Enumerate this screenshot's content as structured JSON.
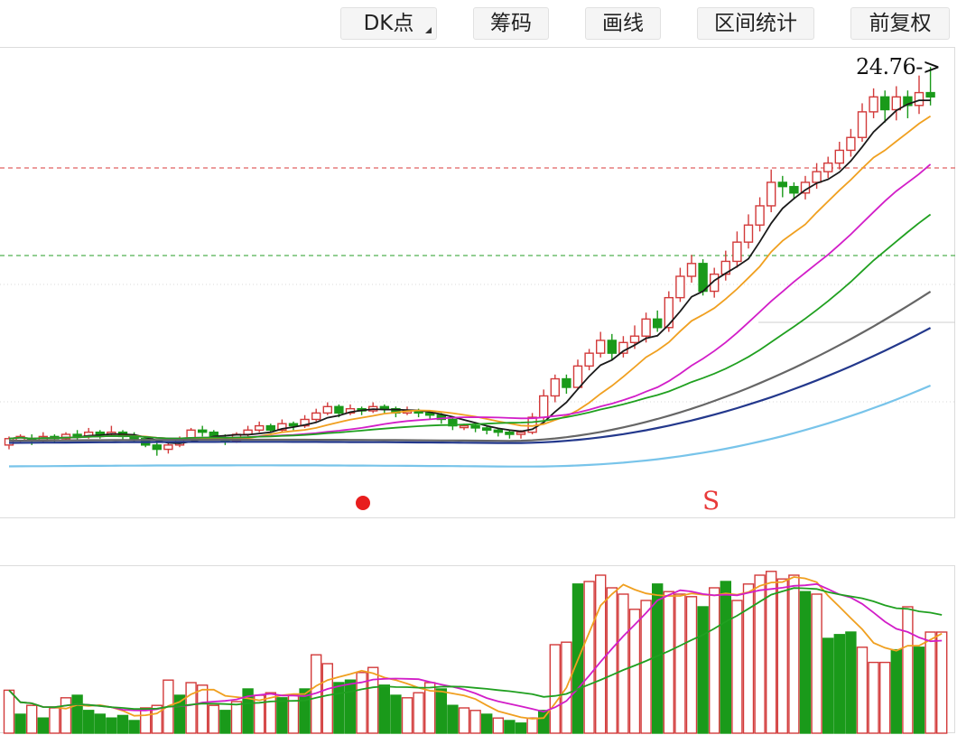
{
  "toolbar": {
    "dk_label": "DK点",
    "chips_label": "筹码",
    "draw_label": "画线",
    "interval_label": "区间统计",
    "adjust_label": "前复权"
  },
  "main_chart": {
    "price_label": "24.76->",
    "sell_marker": "S"
  },
  "colors": {
    "up": "#d23a3a",
    "down": "#1a9a1a",
    "ma5": "#1a1a1a",
    "ma10": "#f0a020",
    "ma20": "#d21ec8",
    "ma30": "#20a020",
    "ma60": "#666666",
    "ma120": "#23388c",
    "ma250": "#78c4ea"
  },
  "chart_data": {
    "type": "candlestick",
    "title": "",
    "reference_lines": [
      {
        "color": "#e06060",
        "style": "dashed"
      },
      {
        "color": "#50b050",
        "style": "dashed"
      }
    ],
    "candles": [
      [
        10.3,
        10.6,
        10.1,
        10.7
      ],
      [
        10.5,
        10.7,
        10.4,
        10.8
      ],
      [
        10.6,
        10.5,
        10.3,
        10.8
      ],
      [
        10.5,
        10.7,
        10.4,
        10.9
      ],
      [
        10.7,
        10.6,
        10.4,
        10.8
      ],
      [
        10.6,
        10.8,
        10.5,
        10.9
      ],
      [
        10.8,
        10.7,
        10.5,
        11.0
      ],
      [
        10.7,
        10.9,
        10.6,
        11.1
      ],
      [
        10.9,
        10.8,
        10.6,
        11.0
      ],
      [
        10.8,
        10.9,
        10.7,
        11.2
      ],
      [
        10.9,
        10.7,
        10.5,
        11.0
      ],
      [
        10.7,
        10.6,
        10.4,
        10.9
      ],
      [
        10.6,
        10.3,
        10.2,
        10.7
      ],
      [
        10.3,
        10.1,
        9.8,
        10.4
      ],
      [
        10.1,
        10.3,
        9.9,
        10.4
      ],
      [
        10.3,
        10.6,
        10.2,
        10.7
      ],
      [
        10.6,
        11.0,
        10.5,
        11.1
      ],
      [
        11.0,
        10.9,
        10.7,
        11.2
      ],
      [
        10.9,
        10.7,
        10.6,
        11.0
      ],
      [
        10.6,
        10.5,
        10.3,
        10.8
      ],
      [
        10.5,
        10.8,
        10.4,
        10.9
      ],
      [
        10.8,
        11.0,
        10.7,
        11.2
      ],
      [
        11.0,
        11.2,
        10.9,
        11.4
      ],
      [
        11.2,
        11.0,
        10.9,
        11.3
      ],
      [
        11.0,
        11.3,
        10.9,
        11.5
      ],
      [
        11.3,
        11.2,
        11.0,
        11.4
      ],
      [
        11.2,
        11.5,
        11.1,
        11.7
      ],
      [
        11.5,
        11.8,
        11.4,
        12.0
      ],
      [
        11.8,
        12.1,
        11.7,
        12.3
      ],
      [
        12.1,
        11.8,
        11.6,
        12.2
      ],
      [
        11.8,
        12.0,
        11.7,
        12.2
      ],
      [
        12.0,
        11.9,
        11.7,
        12.1
      ],
      [
        11.9,
        12.1,
        11.8,
        12.3
      ],
      [
        12.1,
        12.0,
        11.8,
        12.2
      ],
      [
        12.0,
        11.8,
        11.6,
        12.1
      ],
      [
        11.8,
        11.9,
        11.7,
        12.1
      ],
      [
        11.9,
        11.8,
        11.6,
        12.0
      ],
      [
        11.8,
        11.7,
        11.5,
        11.9
      ],
      [
        11.7,
        11.5,
        11.3,
        11.8
      ],
      [
        11.5,
        11.2,
        11.0,
        11.6
      ],
      [
        11.2,
        11.2,
        11.0,
        11.3
      ],
      [
        11.2,
        11.1,
        10.9,
        11.3
      ],
      [
        11.1,
        11.0,
        10.8,
        11.2
      ],
      [
        11.0,
        10.9,
        10.7,
        11.1
      ],
      [
        10.9,
        10.8,
        10.6,
        11.0
      ],
      [
        10.8,
        10.9,
        10.6,
        11.0
      ],
      [
        10.9,
        11.6,
        10.8,
        11.8
      ],
      [
        11.6,
        12.6,
        11.4,
        12.9
      ],
      [
        12.6,
        13.4,
        12.3,
        13.6
      ],
      [
        13.4,
        13.0,
        12.7,
        13.6
      ],
      [
        13.0,
        14.0,
        12.9,
        14.3
      ],
      [
        14.0,
        14.6,
        13.8,
        14.8
      ],
      [
        14.6,
        15.2,
        14.4,
        15.6
      ],
      [
        15.2,
        14.6,
        14.3,
        15.5
      ],
      [
        14.6,
        15.1,
        14.4,
        15.4
      ],
      [
        15.1,
        15.4,
        14.8,
        15.9
      ],
      [
        15.4,
        16.2,
        15.1,
        16.5
      ],
      [
        16.2,
        15.8,
        15.6,
        16.6
      ],
      [
        15.8,
        17.2,
        15.6,
        17.5
      ],
      [
        17.2,
        18.2,
        17.0,
        18.6
      ],
      [
        18.2,
        18.8,
        17.9,
        19.2
      ],
      [
        18.8,
        17.5,
        17.3,
        19.0
      ],
      [
        17.5,
        18.3,
        17.2,
        18.6
      ],
      [
        18.3,
        18.9,
        18.0,
        19.4
      ],
      [
        18.9,
        19.8,
        18.6,
        20.3
      ],
      [
        19.8,
        20.6,
        19.5,
        21.1
      ],
      [
        20.6,
        21.5,
        20.3,
        21.9
      ],
      [
        21.5,
        22.6,
        21.2,
        23.2
      ],
      [
        22.6,
        22.4,
        21.9,
        22.9
      ],
      [
        22.4,
        22.1,
        21.8,
        22.6
      ],
      [
        22.1,
        22.6,
        21.8,
        22.9
      ],
      [
        22.6,
        23.1,
        22.3,
        23.5
      ],
      [
        23.1,
        23.5,
        22.8,
        23.8
      ],
      [
        23.5,
        24.1,
        23.2,
        24.5
      ],
      [
        24.1,
        24.7,
        23.8,
        25.1
      ],
      [
        24.7,
        25.9,
        24.5,
        26.3
      ],
      [
        25.9,
        26.6,
        25.6,
        27.0
      ],
      [
        26.6,
        26.0,
        25.4,
        26.9
      ],
      [
        26.0,
        26.6,
        25.5,
        27.1
      ],
      [
        26.6,
        26.2,
        25.6,
        26.9
      ],
      [
        26.2,
        26.8,
        25.8,
        27.6
      ],
      [
        26.8,
        26.6,
        26.2,
        28.0
      ]
    ],
    "ma_series": [
      {
        "period": 5,
        "color": "#1a1a1a"
      },
      {
        "period": 10,
        "color": "#f0a020"
      },
      {
        "period": 20,
        "color": "#d21ec8"
      },
      {
        "period": 30,
        "color": "#20a020"
      },
      {
        "period": 60,
        "color": "#666666"
      },
      {
        "period": 120,
        "color": "#23388c"
      },
      {
        "period": 250,
        "color": "#78c4ea"
      }
    ],
    "volume": [
      34,
      15,
      22,
      12,
      20,
      28,
      30,
      18,
      15,
      12,
      14,
      10,
      20,
      22,
      42,
      30,
      40,
      38,
      22,
      18,
      25,
      35,
      30,
      32,
      28,
      30,
      35,
      62,
      55,
      40,
      42,
      48,
      52,
      38,
      30,
      28,
      32,
      40,
      35,
      22,
      20,
      18,
      15,
      12,
      10,
      8,
      12,
      18,
      70,
      72,
      118,
      120,
      125,
      115,
      110,
      98,
      105,
      118,
      112,
      110,
      108,
      100,
      115,
      120,
      105,
      118,
      125,
      128,
      122,
      125,
      112,
      110,
      75,
      78,
      80,
      68,
      56,
      56,
      66,
      100,
      68,
      80,
      80
    ],
    "volume_up": [
      true,
      false,
      true,
      false,
      true,
      true,
      false,
      false,
      false,
      false,
      false,
      false,
      true,
      true,
      true,
      false,
      true,
      true,
      true,
      false,
      true,
      false,
      true,
      true,
      false,
      true,
      false,
      true,
      true,
      false,
      false,
      true,
      true,
      false,
      false,
      true,
      true,
      true,
      false,
      false,
      true,
      true,
      false,
      true,
      false,
      false,
      true,
      false,
      true,
      true,
      false,
      true,
      true,
      true,
      true,
      true,
      true,
      false,
      true,
      true,
      true,
      false,
      true,
      false,
      true,
      true,
      true,
      true,
      true,
      true,
      false,
      true,
      false,
      false,
      false,
      true,
      true,
      true,
      false,
      true,
      false,
      true,
      true
    ],
    "volume_ma": [
      {
        "period": 5,
        "color": "#f0a020"
      },
      {
        "period": 10,
        "color": "#d21ec8"
      },
      {
        "period": 20,
        "color": "#20a020"
      }
    ]
  }
}
